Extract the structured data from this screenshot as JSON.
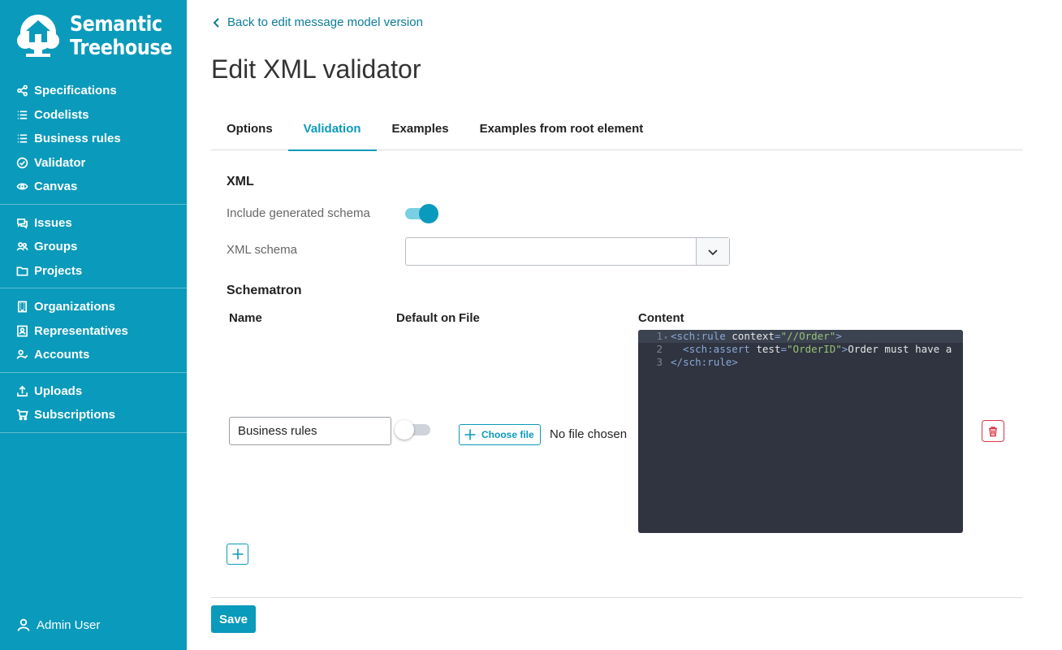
{
  "brand": {
    "line1": "Semantic",
    "line2": "Treehouse",
    "logo_icon": "treehouse-logo"
  },
  "sidebar": {
    "groups": [
      [
        {
          "label": "Specifications",
          "icon": "share-icon"
        },
        {
          "label": "Codelists",
          "icon": "list-icon"
        },
        {
          "label": "Business rules",
          "icon": "list-icon"
        },
        {
          "label": "Validator",
          "icon": "check-circle-icon"
        },
        {
          "label": "Canvas",
          "icon": "eye-icon"
        }
      ],
      [
        {
          "label": "Issues",
          "icon": "chat-icon"
        },
        {
          "label": "Groups",
          "icon": "people-icon"
        },
        {
          "label": "Projects",
          "icon": "folder-icon"
        }
      ],
      [
        {
          "label": "Organizations",
          "icon": "building-icon"
        },
        {
          "label": "Representatives",
          "icon": "contact-icon"
        },
        {
          "label": "Accounts",
          "icon": "user-check-icon"
        }
      ],
      [
        {
          "label": "Uploads",
          "icon": "upload-icon"
        },
        {
          "label": "Subscriptions",
          "icon": "cart-icon"
        }
      ]
    ],
    "user": "Admin User"
  },
  "header": {
    "back_link": "Back to edit message model version",
    "title": "Edit XML validator"
  },
  "tabs": [
    {
      "label": "Options",
      "active": false
    },
    {
      "label": "Validation",
      "active": true
    },
    {
      "label": "Examples",
      "active": false
    },
    {
      "label": "Examples from root element",
      "active": false
    }
  ],
  "xml": {
    "section_title": "XML",
    "include_schema_label": "Include generated schema",
    "include_schema_on": true,
    "schema_label": "XML schema",
    "schema_value": ""
  },
  "schematron": {
    "section_title": "Schematron",
    "columns": {
      "name": "Name",
      "default_on": "Default on",
      "file": "File",
      "content": "Content"
    },
    "rows": [
      {
        "name": "Business rules",
        "default_on": false,
        "choose_file_label": "Choose file",
        "file_status": "No file chosen",
        "code_lines": [
          {
            "num": "1",
            "tag_open": "<",
            "tag": "sch:rule",
            "attr": " context",
            "eq": "=",
            "str": "\"//Order\"",
            "close": ">",
            "text": ""
          },
          {
            "num": "2",
            "tag_open": "  <",
            "tag": "sch:assert",
            "attr": " test",
            "eq": "=",
            "str": "\"OrderID\"",
            "close": ">",
            "text": "Order must have a"
          },
          {
            "num": "3",
            "tag_open": "</",
            "tag": "sch:rule",
            "attr": "",
            "eq": "",
            "str": "",
            "close": ">",
            "text": ""
          }
        ]
      }
    ]
  },
  "footer": {
    "save_label": "Save"
  },
  "colors": {
    "primary": "#0a9abb",
    "danger": "#dc3545",
    "editor_bg": "#2f3440"
  }
}
